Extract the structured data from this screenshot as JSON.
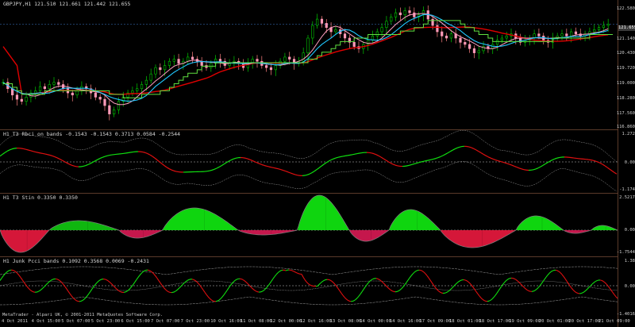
{
  "main_chart": {
    "title": "GBPJPY,H1  121.510 121.661 121.442 121.655",
    "price_ticks": [
      "122.580",
      "121.140",
      "120.430",
      "119.720",
      "119.000",
      "118.280",
      "117.560",
      "116.860"
    ],
    "current_price": "121.655",
    "candle_closes": [
      118.9,
      118.6,
      118.3,
      118.1,
      118.0,
      118.2,
      118.4,
      118.5,
      118.7,
      118.6,
      118.8,
      118.9,
      118.8,
      118.6,
      118.4,
      118.3,
      118.5,
      118.7,
      118.6,
      118.4,
      118.2,
      118.1,
      117.8,
      117.4,
      117.6,
      118.0,
      118.2,
      118.4,
      118.5,
      118.6,
      118.8,
      119.0,
      119.3,
      119.6,
      119.5,
      119.7,
      119.9,
      120.0,
      119.8,
      119.9,
      120.1,
      120.0,
      119.9,
      119.7,
      119.6,
      119.8,
      120.0,
      119.9,
      119.7,
      119.8,
      119.9,
      119.8,
      119.6,
      119.8,
      120.0,
      119.9,
      119.7,
      119.6,
      119.5,
      119.7,
      119.9,
      120.1,
      120.0,
      119.8,
      119.9,
      120.3,
      121.0,
      121.6,
      121.9,
      121.7,
      121.5,
      121.3,
      121.4,
      121.2,
      121.0,
      120.8,
      120.6,
      120.5,
      120.7,
      120.9,
      121.1,
      121.3,
      121.5,
      121.8,
      122.0,
      122.2,
      122.1,
      122.3,
      122.2,
      122.0,
      122.1,
      122.3,
      121.9,
      121.6,
      121.3,
      121.1,
      121.0,
      121.2,
      121.0,
      120.8,
      120.7,
      120.5,
      120.3,
      120.4,
      120.6,
      120.5,
      120.7,
      120.9,
      121.0,
      121.1,
      121.2,
      121.0,
      120.8,
      120.9,
      121.0,
      121.2,
      121.1,
      120.9,
      120.8,
      121.0,
      121.1,
      121.2,
      121.1,
      121.3,
      121.2,
      121.1,
      121.2,
      121.3,
      121.4,
      121.5,
      121.6,
      121.66
    ],
    "legend": []
  },
  "t3_rbci": {
    "title": "H1  T3 Rbci on bands  -0.1543 -0.1543 0.3713 0.0584 -0.2544",
    "ticks": [
      "1.272",
      "0.00",
      "-1.174"
    ]
  },
  "t3_stin": {
    "title": "H1  T3 Stin  0.3350 0.3350",
    "ticks": [
      "2.5217",
      "0.00",
      "-1.7544"
    ]
  },
  "junk_pcci": {
    "title": "H1 Junk Pcci bands  0.1092 0.3568 0.0069 -0.2431",
    "ticks": [
      "1.38",
      "0.00",
      "-1.4016"
    ]
  },
  "x_axis": [
    "4 Oct 2011",
    "4 Oct 15:00",
    "5 Oct 07:00",
    "5 Oct 23:00",
    "6 Oct 15:00",
    "7 Oct 07:00",
    "7 Oct 23:00",
    "10 Oct 16:00",
    "11 Oct 08:00",
    "12 Oct 00:00",
    "12 Oct 16:00",
    "13 Oct 08:00",
    "14 Oct 00:00",
    "14 Oct 16:00",
    "17 Oct 09:00",
    "18 Oct 01:00",
    "18 Oct 17:00",
    "19 Oct 09:00",
    "20 Oct 01:00",
    "20 Oct 17:00",
    "21 Oct 09:00"
  ],
  "credit": "MetaTrader - Alpari UK, © 2001-2011 MetaQuotes Software Corp.",
  "colors": {
    "up": "#00c800",
    "down": "#ff3030",
    "bg": "#000000",
    "green": "#00e000",
    "red": "#e00000",
    "pink": "#ff9fc0",
    "cyan": "#20c8ff",
    "lime": "#9cff3c"
  }
}
